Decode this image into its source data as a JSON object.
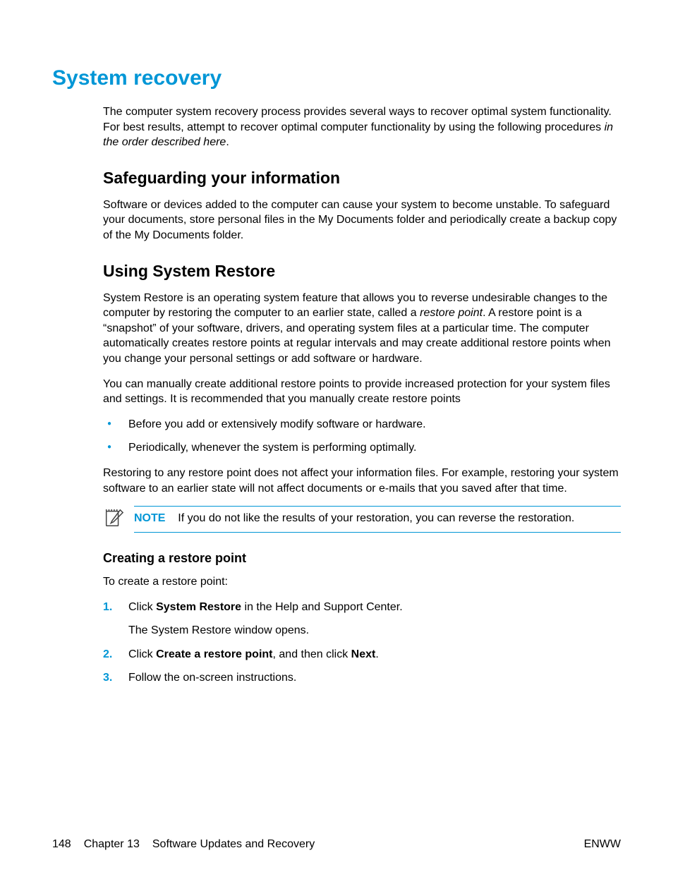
{
  "title": "System recovery",
  "intro": {
    "p1a": "The computer system recovery process provides several ways to recover optimal system functionality. For best results, attempt to recover optimal computer functionality by using the following procedures ",
    "p1b": "in the order described here",
    "p1c": "."
  },
  "section1": {
    "heading": "Safeguarding your information",
    "p1": "Software or devices added to the computer can cause your system to become unstable. To safeguard your documents, store personal files in the My Documents folder and periodically create a backup copy of the My Documents folder."
  },
  "section2": {
    "heading": "Using System Restore",
    "p1a": "System Restore is an operating system feature that allows you to reverse undesirable changes to the computer by restoring the computer to an earlier state, called a ",
    "p1b": "restore point",
    "p1c": ". A restore point is a “snapshot” of your software, drivers, and operating system files at a particular time. The computer automatically creates restore points at regular intervals and may create additional restore points when you change your personal settings or add software or hardware.",
    "p2": "You can manually create additional restore points to provide increased protection for your system files and settings. It is recommended that you manually create restore points",
    "bullets": [
      "Before you add or extensively modify software or hardware.",
      "Periodically, whenever the system is performing optimally."
    ],
    "p3": "Restoring to any restore point does not affect your information files. For example, restoring your system software to an earlier state will not affect documents or e-mails that you saved after that time.",
    "note": {
      "label": "NOTE",
      "text": "If you do not like the results of your restoration, you can reverse the restoration."
    }
  },
  "subsection": {
    "heading": "Creating a restore point",
    "p1": "To create a restore point:",
    "steps": {
      "s1a": "Click ",
      "s1b": "System Restore",
      "s1c": " in the Help and Support Center.",
      "s1sub": "The System Restore window opens.",
      "s2a": "Click ",
      "s2b": "Create a restore point",
      "s2c": ", and then click ",
      "s2d": "Next",
      "s2e": ".",
      "s3": "Follow the on-screen instructions."
    }
  },
  "footer": {
    "page": "148",
    "chapter": "Chapter 13",
    "chapterTitle": "Software Updates and Recovery",
    "right": "ENWW"
  }
}
